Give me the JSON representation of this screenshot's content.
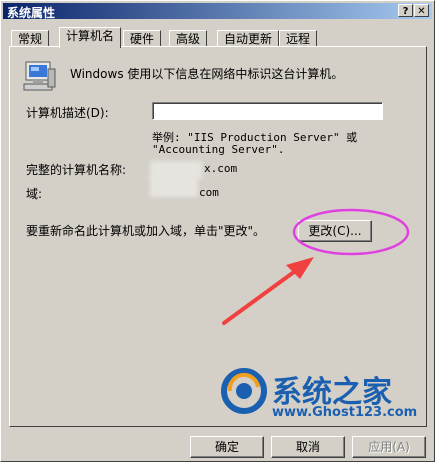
{
  "window": {
    "title": "系统属性",
    "help_button": "?",
    "close_button": "✕"
  },
  "tabs": [
    {
      "label": "常规"
    },
    {
      "label": "计算机名"
    },
    {
      "label": "硬件"
    },
    {
      "label": "高级"
    },
    {
      "label": "自动更新"
    },
    {
      "label": "远程"
    }
  ],
  "panel": {
    "intro_text": "Windows 使用以下信息在网络中标识这台计算机。",
    "description_label": "计算机描述(D):",
    "description_value": "",
    "example_line1": "举例: \"IIS Production Server\" 或",
    "example_line2": "\"Accounting Server\".",
    "full_name_label": "完整的计算机名称:",
    "full_name_value_suffix": "x.com",
    "domain_label": "域:",
    "domain_value_suffix": "com",
    "rename_text": "要重新命名此计算机或加入域，单击\"更改\"。",
    "change_button": "更改(C)..."
  },
  "watermark": {
    "brand": "系统之家",
    "url": "www.Ghost123.com"
  },
  "footer": {
    "ok_button": "确定",
    "cancel_button": "取消",
    "apply_button": "应用(A)"
  },
  "colors": {
    "annotation": "#e040e0",
    "arrow": "#f04040",
    "title_start": "#0a246a",
    "title_end": "#a6caf0"
  }
}
